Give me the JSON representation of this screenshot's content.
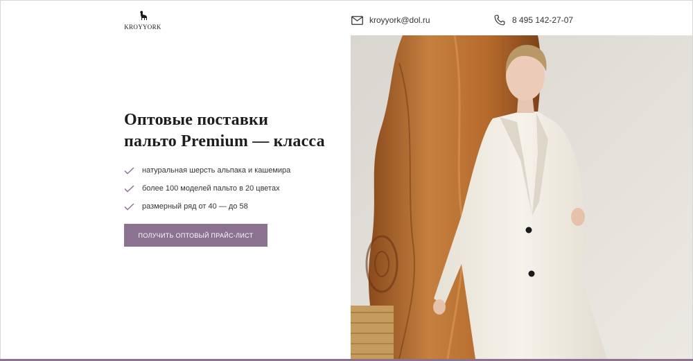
{
  "header": {
    "logo_text": "KROYYORK",
    "email": "kroyyork@dol.ru",
    "phone": "8 495 142-27-07"
  },
  "hero": {
    "title_line1": "Оптовые поставки",
    "title_line2": "пальто Premium — класса",
    "features": [
      "натуральная шерсть альпака и кашемира",
      "более 100 моделей пальто в 20 цветах",
      "размерный ряд от 40 — до 58"
    ],
    "cta_label": "получить оптовый прайс-лист"
  },
  "colors": {
    "accent": "#8a7290",
    "check": "#8a7290",
    "background": "#ffffff",
    "coat": "#f1ede2",
    "wood": "#b86a2e",
    "wall": "#e5e2dc"
  },
  "icons": {
    "logo": "alpaca-icon",
    "email": "mail-icon",
    "phone": "phone-icon",
    "feature": "check-icon"
  }
}
